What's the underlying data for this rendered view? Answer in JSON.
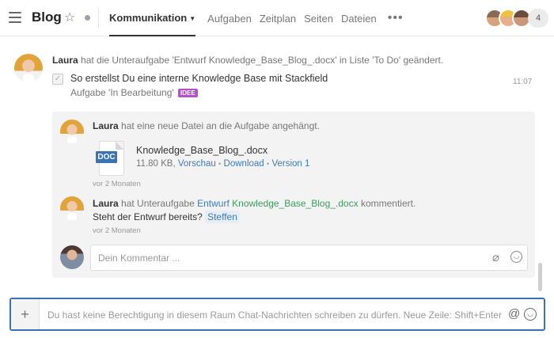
{
  "header": {
    "title": "Blog",
    "nav": [
      {
        "label": "Kommunikation",
        "active": true
      },
      {
        "label": "Aufgaben"
      },
      {
        "label": "Zeitplan"
      },
      {
        "label": "Seiten"
      },
      {
        "label": "Dateien"
      }
    ],
    "more": "•••",
    "member_count": "4"
  },
  "activity": {
    "author": "Laura",
    "action": "hat die Unteraufgabe 'Entwurf Knowledge_Base_Blog_.docx' in Liste 'To Do' geändert.",
    "task_title": "So erstellst Du eine interne Knowledge Base mit Stackfield",
    "task_status": "Aufgabe 'In Bearbeitung'",
    "tag": "IDEE",
    "time": "11:07"
  },
  "thread": {
    "file_post": {
      "author": "Laura",
      "action": "hat eine neue Datei an die Aufgabe angehängt.",
      "file_type": "DOC",
      "file_name": "Knowledge_Base_Blog_.docx",
      "file_size": "11.80 KB,",
      "preview": "Vorschau",
      "download": "Download",
      "version": "Version 1",
      "separator": "•",
      "time": "vor 2 Monaten"
    },
    "comment": {
      "author": "Laura",
      "action": "hat Unteraufgabe",
      "task_link": "Entwurf",
      "file_link": "Knowledge_Base_Blog_.docx",
      "action_end": "kommentiert.",
      "text": "Steht der Entwurf bereits?",
      "mention": "Steffen",
      "time": "vor 2 Monaten"
    },
    "reply_placeholder": "Dein Kommentar ..."
  },
  "composer": {
    "message": "Du hast keine Berechtigung in diesem Raum Chat-Nachrichten schreiben zu dürfen.  Neue Zeile: Shift+Enter",
    "plus": "+",
    "at": "@"
  }
}
